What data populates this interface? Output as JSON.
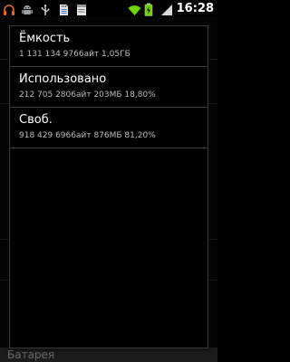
{
  "status_bar": {
    "time": "16:28",
    "left_icons": [
      "headphones-icon",
      "android-icon",
      "usb-icon",
      "sd-card-icon",
      "storage-icon"
    ],
    "right_icons": [
      "wifi-icon",
      "battery-charging-icon",
      "signal-icon"
    ],
    "colors": {
      "headphones": "#e86a1c",
      "android": "#9aa0a6",
      "wifi": "#6dd400",
      "battery": "#6dd400"
    }
  },
  "dialog": {
    "items": [
      {
        "title": "Ёмкость",
        "subtitle": "1 131 134 9766айт 1,05ГБ"
      },
      {
        "title": "Использовано",
        "subtitle": "212 705 2806айт 203МБ 18,80%"
      },
      {
        "title": "Своб.",
        "subtitle": "918 429 6966айт 876МБ 81,20%"
      }
    ]
  },
  "background": {
    "section_label": "Батарея"
  }
}
